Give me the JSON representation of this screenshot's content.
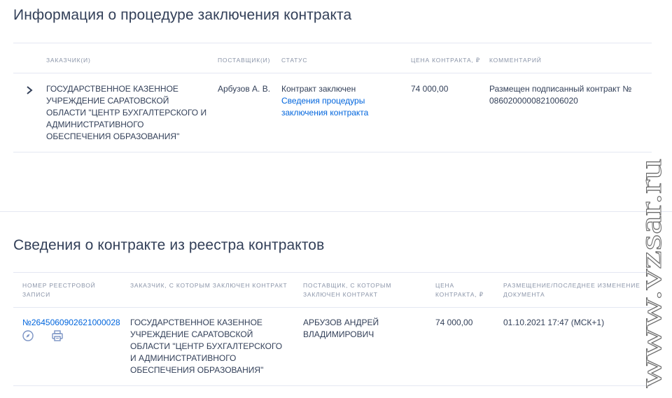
{
  "procedure": {
    "title": "Информация о процедуре заключения контракта",
    "headers": {
      "customer": "ЗАКАЗЧИК(И)",
      "supplier": "ПОСТАВЩИК(И)",
      "status": "СТАТУС",
      "price": "ЦЕНА КОНТРАКТА, ₽",
      "comment": "КОММЕНТАРИЙ"
    },
    "row": {
      "customer": "ГОСУДАРСТВЕННОЕ КАЗЕННОЕ УЧРЕЖДЕНИЕ САРАТОВСКОЙ ОБЛАСТИ \"ЦЕНТР БУХГАЛТЕРСКОГО И АДМИНИСТРАТИВНОГО ОБЕСПЕЧЕНИЯ ОБРАЗОВАНИЯ\"",
      "supplier": "Арбузов А. В.",
      "status": "Контракт заключен",
      "status_link": "Сведения процедуры заключения контракта",
      "price": "74 000,00",
      "comment": "Размещен подписанный контракт № 0860200000821006020"
    }
  },
  "registry": {
    "title": "Сведения о контракте из реестра контрактов",
    "headers": {
      "number": "НОМЕР РЕЕСТРОВОЙ ЗАПИСИ",
      "customer": "ЗАКАЗЧИК, С КОТОРЫМ ЗАКЛЮЧЕН КОНТРАКТ",
      "supplier": "ПОСТАВЩИК, С КОТОРЫМ ЗАКЛЮЧЕН КОНТРАКТ",
      "price": "ЦЕНА КОНТРАКТА, ₽",
      "placement": "РАЗМЕЩЕНИЕ/ПОСЛЕДНЕЕ ИЗМЕНЕНИЕ ДОКУМЕНТА"
    },
    "row": {
      "number": "№2645060902621000028",
      "customer": "ГОСУДАРСТВЕННОЕ КАЗЕННОЕ УЧРЕЖДЕНИЕ САРАТОВСКОЙ ОБЛАСТИ \"ЦЕНТР БУХГАЛТЕРСКОГО И АДМИНИСТРАТИВНОГО ОБЕСПЕЧЕНИЯ ОБРАЗОВАНИЯ\"",
      "supplier": "АРБУЗОВ АНДРЕЙ ВЛАДИМИРОВИЧ",
      "price": "74 000,00",
      "placement": "01.10.2021 17:47 (МСК+1)"
    },
    "icons": [
      "compass-icon",
      "print-icon"
    ]
  },
  "watermark": "www.vzsar.ru",
  "colors": {
    "text": "#334059",
    "link": "#0065dd",
    "muted": "#8a94a8",
    "divider": "#e4e7f2"
  }
}
